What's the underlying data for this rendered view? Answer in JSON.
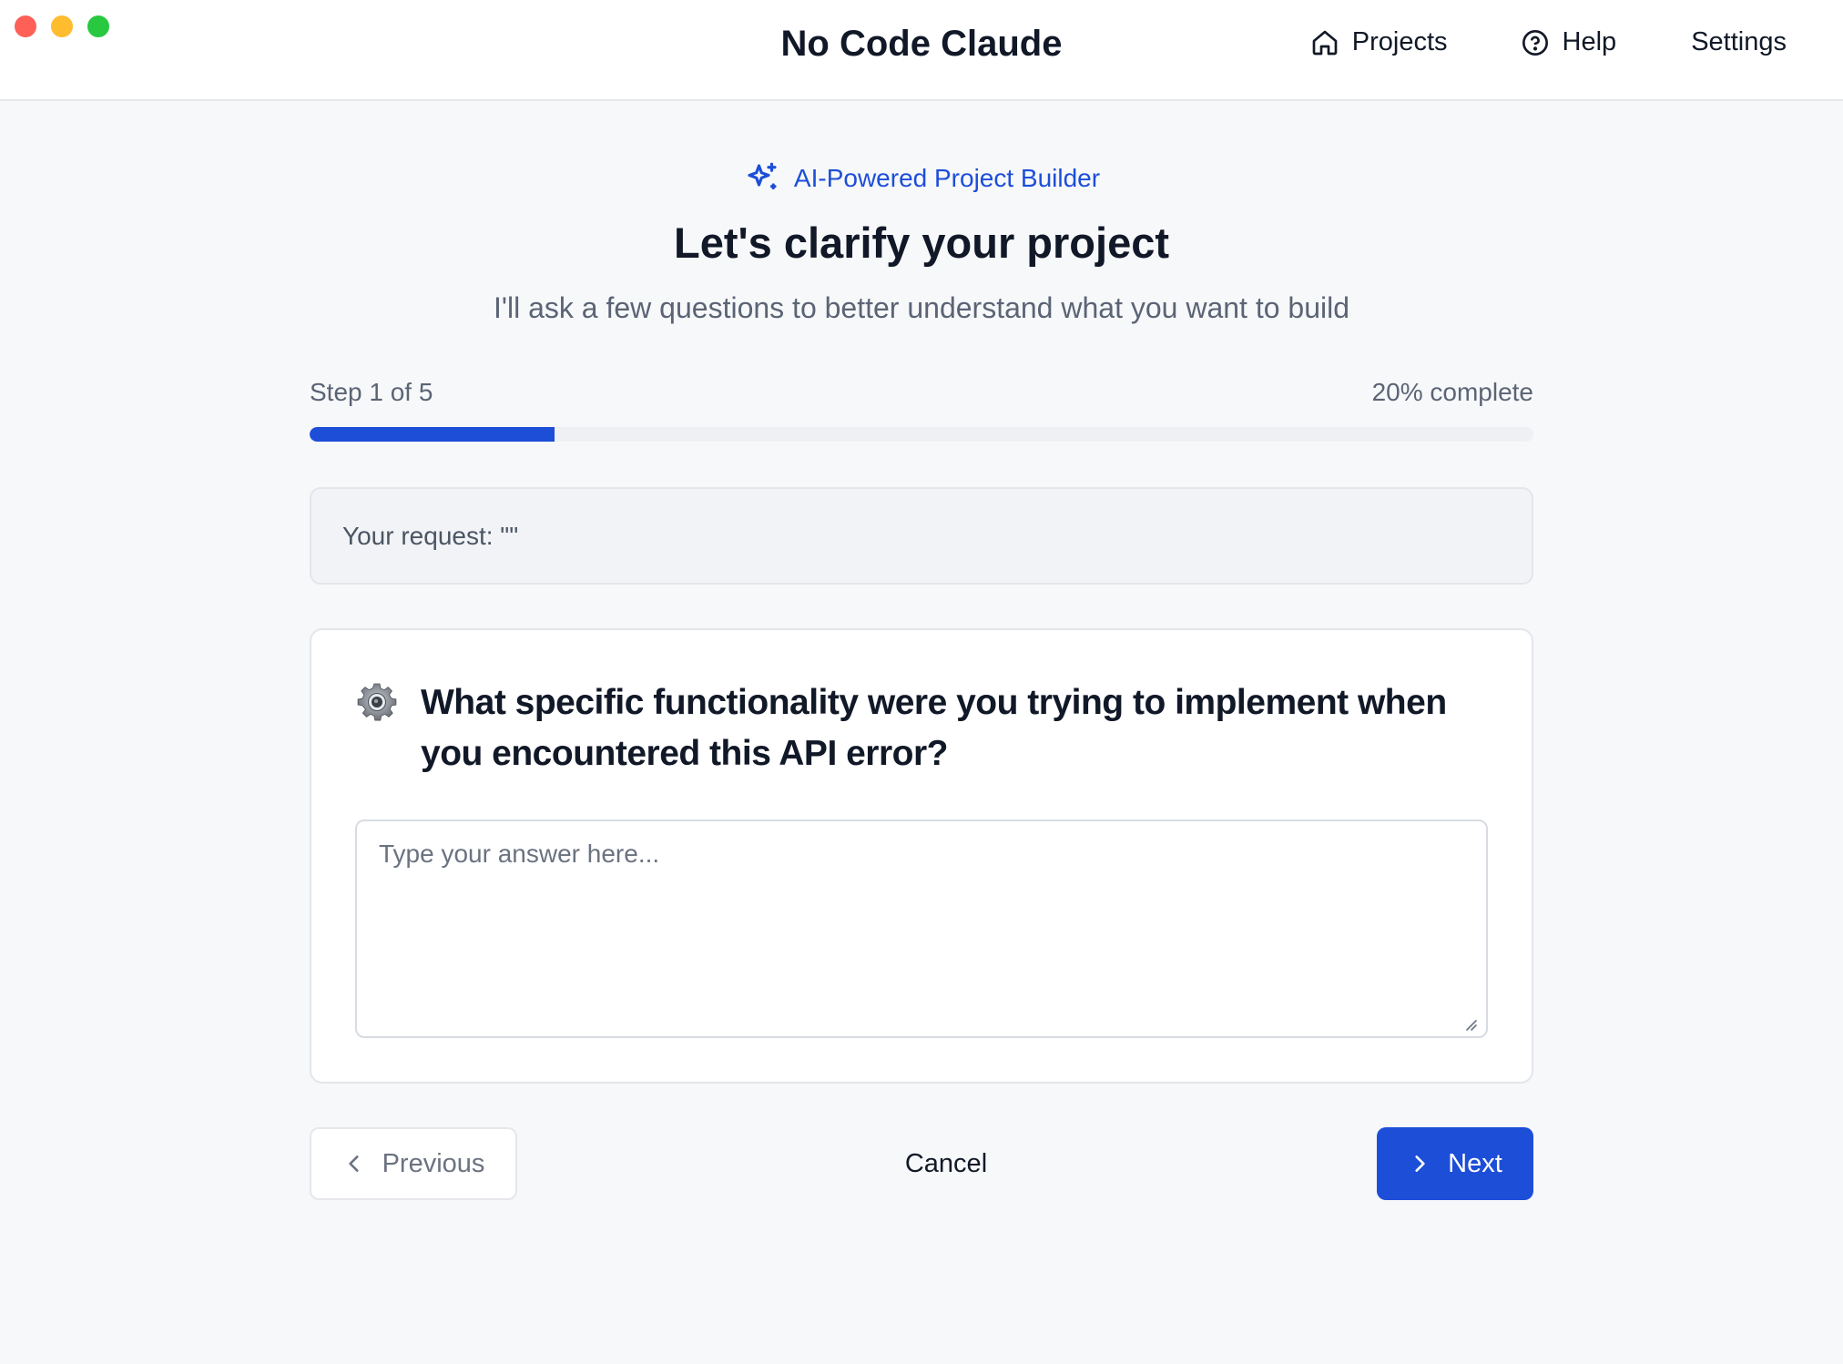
{
  "window": {
    "app_title": "No Code Claude",
    "traffic_lights": [
      "close",
      "minimize",
      "zoom"
    ]
  },
  "nav": {
    "projects": {
      "label": "Projects",
      "icon": "home-icon"
    },
    "help": {
      "label": "Help",
      "icon": "help-circle-icon"
    },
    "settings": {
      "label": "Settings"
    }
  },
  "header": {
    "badge": "AI-Powered Project Builder",
    "badge_icon": "sparkles-icon",
    "title": "Let's clarify your project",
    "subtitle": "I'll ask a few questions to better understand what you want to build"
  },
  "progress": {
    "step_label": "Step 1 of 5",
    "percent_label": "20% complete",
    "fraction": 0.2
  },
  "request": {
    "text": "Your request: \"\""
  },
  "question": {
    "icon": "gear-icon",
    "text": "What specific functionality were you trying to implement when you encountered this API error?",
    "answer_value": "",
    "answer_placeholder": "Type your answer here..."
  },
  "actions": {
    "previous": "Previous",
    "cancel": "Cancel",
    "next": "Next"
  },
  "colors": {
    "accent": "#1d4ed8",
    "background": "#f7f8fa",
    "close": "#fe5f57",
    "minimize": "#febc2e",
    "zoom": "#28c840"
  }
}
